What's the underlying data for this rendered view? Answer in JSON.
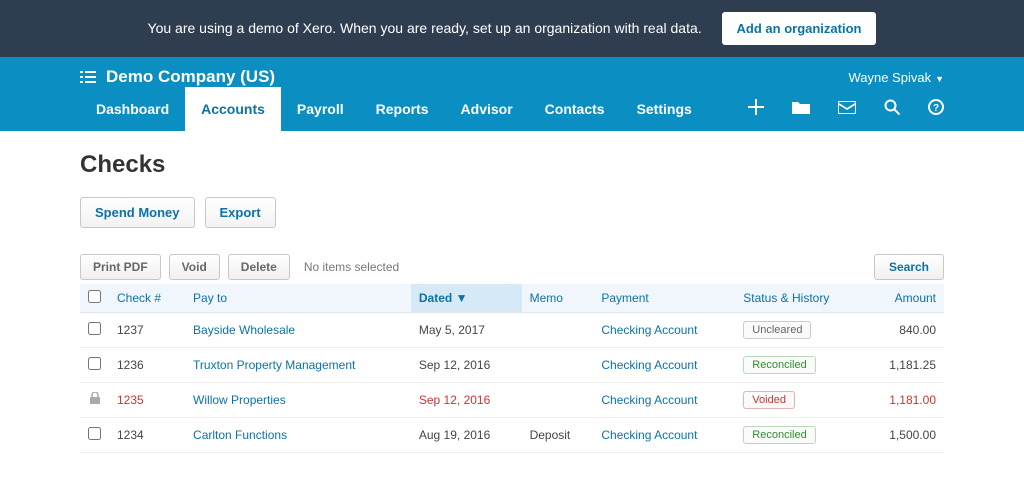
{
  "banner": {
    "text": "You are using a demo of Xero. When you are ready, set up an organization with real data.",
    "cta": "Add an organization"
  },
  "header": {
    "company": "Demo Company (US)",
    "user": "Wayne Spivak"
  },
  "nav": {
    "tabs": [
      "Dashboard",
      "Accounts",
      "Payroll",
      "Reports",
      "Advisor",
      "Contacts",
      "Settings"
    ],
    "active": "Accounts"
  },
  "page": {
    "title": "Checks",
    "actions": {
      "spend": "Spend Money",
      "export": "Export"
    },
    "toolbar": {
      "print": "Print PDF",
      "void": "Void",
      "delete": "Delete",
      "status": "No items selected",
      "search": "Search"
    },
    "columns": {
      "check": "Check #",
      "payto": "Pay to",
      "dated": "Dated",
      "memo": "Memo",
      "payment": "Payment",
      "status": "Status & History",
      "amount": "Amount"
    }
  },
  "rows": [
    {
      "locked": false,
      "check": "1237",
      "payto": "Bayside Wholesale",
      "dated": "May 5, 2017",
      "memo": "",
      "payment": "Checking Account",
      "status": "Uncleared",
      "status_class": "uncleared",
      "amount": "840.00",
      "voided": false
    },
    {
      "locked": false,
      "check": "1236",
      "payto": "Truxton Property Management",
      "dated": "Sep 12, 2016",
      "memo": "",
      "payment": "Checking Account",
      "status": "Reconciled",
      "status_class": "reconciled",
      "amount": "1,181.25",
      "voided": false
    },
    {
      "locked": true,
      "check": "1235",
      "payto": "Willow Properties",
      "dated": "Sep 12, 2016",
      "memo": "",
      "payment": "Checking Account",
      "status": "Voided",
      "status_class": "voided",
      "amount": "1,181.00",
      "voided": true
    },
    {
      "locked": false,
      "check": "1234",
      "payto": "Carlton Functions",
      "dated": "Aug 19, 2016",
      "memo": "Deposit",
      "payment": "Checking Account",
      "status": "Reconciled",
      "status_class": "reconciled",
      "amount": "1,500.00",
      "voided": false
    }
  ]
}
